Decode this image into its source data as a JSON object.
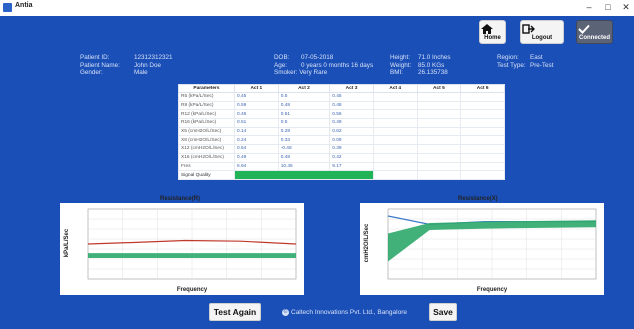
{
  "window": {
    "title": "Antia",
    "minimize": "–",
    "maximize": "□",
    "close": "✕"
  },
  "toolbar": {
    "home": {
      "label": "Home",
      "icon": "home-icon"
    },
    "logout": {
      "label": "Logout",
      "icon": "logout-icon"
    },
    "connected": {
      "label": "Connected",
      "icon": "checkmark-icon"
    }
  },
  "patient": {
    "id_label": "Patient ID:",
    "id": "12312312321",
    "name_label": "Patient Name:",
    "name": "John Doe",
    "gender_label": "Gender:",
    "gender": "Male",
    "dob_label": "DOB:",
    "dob": "07-05-2018",
    "age_label": "Age:",
    "age": "0 years 0 months 16 days",
    "smoker_label": "Smoker:",
    "smoker": "Very Rare",
    "height_label": "Height:",
    "height": "71.0 Inches",
    "weight_label": "Weight:",
    "weight": "85.0 KGs",
    "bmi_label": "BMI:",
    "bmi": "26.135738",
    "region_label": "Region:",
    "region": "East",
    "test_type_label": "Test Type:",
    "test_type": "Pre-Test"
  },
  "table": {
    "headers": [
      "Parameters",
      "Act 1",
      "Act 2",
      "Act 3",
      "Act 4",
      "Act 5",
      "Act 6"
    ],
    "rows": [
      [
        "R5 (kPa/L/Sec)",
        "0.45",
        "0.5",
        "0.45",
        "",
        "",
        ""
      ],
      [
        "R8 (kPa/L/Sec)",
        "0.59",
        "0.48",
        "0.48",
        "",
        "",
        ""
      ],
      [
        "R12 (kPa/L/Sec)",
        "0.46",
        "0.61",
        "0.56",
        "",
        "",
        ""
      ],
      [
        "R16 (kPa/L/Sec)",
        "0.51",
        "0.5",
        "0.49",
        "",
        "",
        ""
      ],
      [
        "X5 (cmH2O/L/Sec)",
        "0.14",
        "0.28",
        "0.62",
        "",
        "",
        ""
      ],
      [
        "X8 (cmH2O/L/Sec)",
        "0.24",
        "0.33",
        "0.09",
        "",
        "",
        ""
      ],
      [
        "X12 (cmH2O/L/Sec)",
        "0.64",
        "-0.48",
        "0.39",
        "",
        "",
        ""
      ],
      [
        "X16 (cmH2O/L/Sec)",
        "0.49",
        "0.48",
        "0.42",
        "",
        "",
        ""
      ],
      [
        "Fres",
        "6.94",
        "10.46",
        "9.17",
        "",
        "",
        ""
      ]
    ],
    "quality_label": "Signal Quality",
    "quality_color": "#22b257"
  },
  "charts": {
    "left_title": "Resistance(R)",
    "left_ylabel": "kPa/L/Sec",
    "left_xlabel": "Frequency",
    "right_title": "Resistance(X)",
    "right_ylabel": "cmH2O/L/Sec",
    "right_xlabel": "Frequency"
  },
  "chart_data": [
    {
      "type": "line",
      "title": "Resistance(R)",
      "xlabel": "Frequency",
      "ylabel": "kPa/L/Sec",
      "series": [
        {
          "color": "#c0392b",
          "x": [
            5,
            8,
            12,
            16,
            20
          ],
          "values": [
            0.5,
            0.52,
            0.55,
            0.54,
            0.5
          ]
        },
        {
          "color": "#2ea86a",
          "x": [
            5,
            20
          ],
          "lower": [
            0.3,
            0.3
          ],
          "upper": [
            0.37,
            0.37
          ]
        }
      ]
    },
    {
      "type": "line",
      "title": "Resistance(X)",
      "xlabel": "Frequency",
      "ylabel": "cmH2O/L/Sec",
      "series": [
        {
          "color": "#3d7ac9",
          "x": [
            5,
            8,
            12,
            16,
            20
          ],
          "values": [
            0.9,
            0.78,
            0.82,
            0.82,
            0.82
          ]
        },
        {
          "color": "#2ea86a",
          "x": [
            5,
            8,
            12,
            20
          ],
          "lower": [
            0.25,
            0.7,
            0.72,
            0.74
          ],
          "upper": [
            0.65,
            0.8,
            0.82,
            0.84
          ]
        }
      ]
    }
  ],
  "buttons": {
    "test_again": "Test Again",
    "save": "Save"
  },
  "footer": {
    "icon": "copyright-icon",
    "text": "Caltech Innovations Pvt. Ltd., Bangalore"
  }
}
